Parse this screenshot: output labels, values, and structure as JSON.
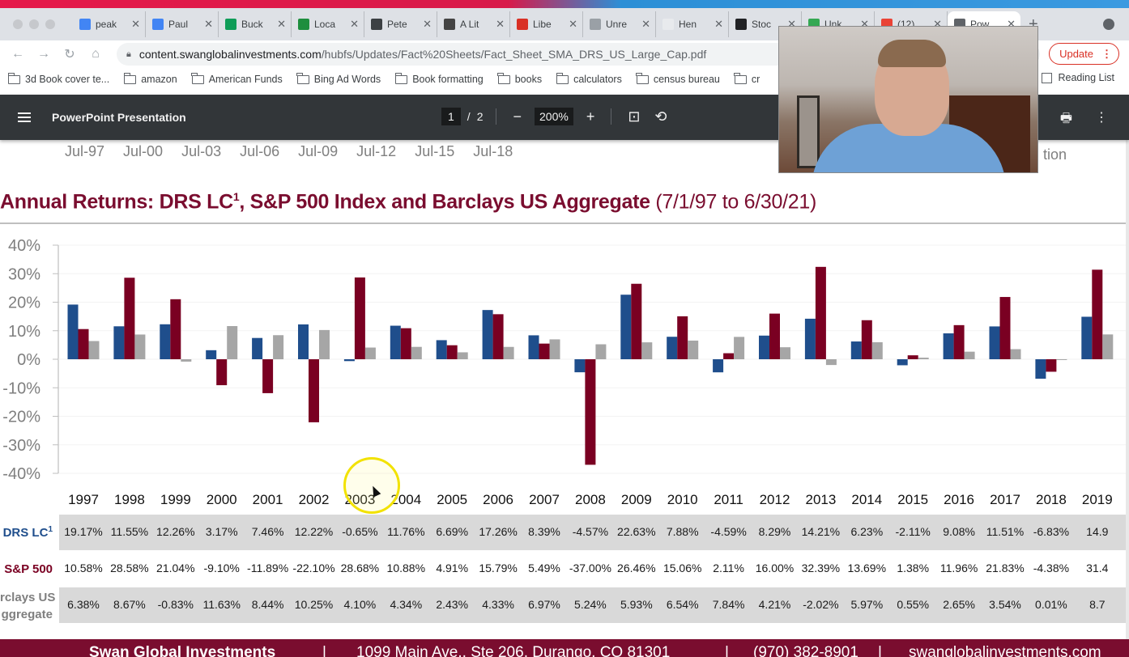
{
  "browser": {
    "tabs": [
      {
        "label": "peak",
        "icon": "google-docs-icon",
        "color": "#4285f4"
      },
      {
        "label": "Paul",
        "icon": "google-docs-icon",
        "color": "#4285f4"
      },
      {
        "label": "Buck",
        "icon": "google-sheets-icon",
        "color": "#0f9d58"
      },
      {
        "label": "Loca",
        "icon": "sheet-app-icon",
        "color": "#1e8e3e"
      },
      {
        "label": "Pete",
        "icon": "globe-icon",
        "color": "#3c4043"
      },
      {
        "label": "A Lit",
        "icon": "cube-icon",
        "color": "#444"
      },
      {
        "label": "Libe",
        "icon": "lc-icon",
        "color": "#d93025"
      },
      {
        "label": "Unre",
        "icon": "page-icon",
        "color": "#9aa0a6"
      },
      {
        "label": "Hen",
        "icon": "blank-icon",
        "color": "#e8eaed"
      },
      {
        "label": "Stoc",
        "icon": "pr-icon",
        "color": "#202124"
      },
      {
        "label": "Unk",
        "icon": "leaf-icon",
        "color": "#34a853"
      },
      {
        "label": "(12)",
        "icon": "red-dot-icon",
        "color": "#ea4335"
      },
      {
        "label": "Pow",
        "icon": "dollar-icon",
        "color": "#5f6368",
        "active": true
      }
    ],
    "new_tab": "+",
    "url_host": "content.swanglobalinvestments.com",
    "url_path": "/hubfs/Updates/Fact%20Sheets/Fact_Sheet_SMA_DRS_US_Large_Cap.pdf",
    "update_label": "Update",
    "bookmarks": [
      "3d Book cover te...",
      "amazon",
      "American Funds",
      "Bing Ad Words",
      "Book formatting",
      "books",
      "calculators",
      "census bureau",
      "cr"
    ],
    "reading_list": "Reading List"
  },
  "pdf_viewer": {
    "title": "PowerPoint Presentation",
    "page_current": "1",
    "page_total": "2",
    "page_sep": "/",
    "zoom": "200%",
    "zoom_out": "−",
    "zoom_in": "+"
  },
  "page": {
    "prev_axis_labels": [
      "Jul-97",
      "Jul-00",
      "Jul-03",
      "Jul-06",
      "Jul-09",
      "Jul-12",
      "Jul-15",
      "Jul-18"
    ],
    "prev_tail_text": "tion",
    "title_main": "Annual Returns: DRS LC",
    "title_sup": "1",
    "title_rest": ", S&P 500 Index and Barclays US Aggregate",
    "title_range": "(7/1/97 to 6/30/21)",
    "footer": {
      "company": "Swan Global Investments",
      "address": "1099 Main Ave., Ste 206, Durango, CO 81301",
      "phone": "(970) 382-8901",
      "web": "swanglobalinvestments.com",
      "sep": "|"
    }
  },
  "chart_data": {
    "type": "bar",
    "title": "Annual Returns: DRS LC1, S&P 500 Index and Barclays US Aggregate (7/1/97 to 6/30/21)",
    "xlabel": "",
    "ylabel": "",
    "ylim": [
      -40,
      40
    ],
    "yticks": [
      "40%",
      "30%",
      "20%",
      "10%",
      "0%",
      "-10%",
      "-20%",
      "-30%",
      "-40%"
    ],
    "ytick_values": [
      40,
      30,
      20,
      10,
      0,
      -10,
      -20,
      -30,
      -40
    ],
    "grid": true,
    "categories": [
      "1997",
      "1998",
      "1999",
      "2000",
      "2001",
      "2002",
      "2003",
      "2004",
      "2005",
      "2006",
      "2007",
      "2008",
      "2009",
      "2010",
      "2011",
      "2012",
      "2013",
      "2014",
      "2015",
      "2016",
      "2017",
      "2018",
      "2019"
    ],
    "series": [
      {
        "name": "DRS LC",
        "label_sup": "1",
        "color": "#1f4e8c",
        "values": [
          19.17,
          11.55,
          12.26,
          3.17,
          7.46,
          12.22,
          -0.65,
          11.76,
          6.69,
          17.26,
          8.39,
          -4.57,
          22.63,
          7.88,
          -4.59,
          8.29,
          14.21,
          6.23,
          -2.11,
          9.08,
          11.51,
          -6.83,
          14.9
        ],
        "labels": [
          "19.17%",
          "11.55%",
          "12.26%",
          "3.17%",
          "7.46%",
          "12.22%",
          "-0.65%",
          "11.76%",
          "6.69%",
          "17.26%",
          "8.39%",
          "-4.57%",
          "22.63%",
          "7.88%",
          "-4.59%",
          "8.29%",
          "14.21%",
          "6.23%",
          "-2.11%",
          "9.08%",
          "11.51%",
          "-6.83%",
          "14.9"
        ]
      },
      {
        "name": "S&P 500",
        "label_sup": "",
        "color": "#7a0022",
        "values": [
          10.58,
          28.58,
          21.04,
          -9.1,
          -11.89,
          -22.1,
          28.68,
          10.88,
          4.91,
          15.79,
          5.49,
          -37.0,
          26.46,
          15.06,
          2.11,
          16.0,
          32.39,
          13.69,
          1.38,
          11.96,
          21.83,
          -4.38,
          31.4
        ],
        "labels": [
          "10.58%",
          "28.58%",
          "21.04%",
          "-9.10%",
          "-11.89%",
          "-22.10%",
          "28.68%",
          "10.88%",
          "4.91%",
          "15.79%",
          "5.49%",
          "-37.00%",
          "26.46%",
          "15.06%",
          "2.11%",
          "16.00%",
          "32.39%",
          "13.69%",
          "1.38%",
          "11.96%",
          "21.83%",
          "-4.38%",
          "31.4"
        ]
      },
      {
        "name": "Barclays US Aggregate",
        "label_line1": "rclays US",
        "label_line2": "ggregate",
        "label_sup": "",
        "color": "#a6a6a6",
        "values": [
          6.38,
          8.67,
          -0.83,
          11.63,
          8.44,
          10.25,
          4.1,
          4.34,
          2.43,
          4.33,
          6.97,
          5.24,
          5.93,
          6.54,
          7.84,
          4.21,
          -2.02,
          5.97,
          0.55,
          2.65,
          3.54,
          0.01,
          8.7
        ],
        "labels": [
          "6.38%",
          "8.67%",
          "-0.83%",
          "11.63%",
          "8.44%",
          "10.25%",
          "4.10%",
          "4.34%",
          "2.43%",
          "4.33%",
          "6.97%",
          "5.24%",
          "5.93%",
          "6.54%",
          "7.84%",
          "4.21%",
          "-2.02%",
          "5.97%",
          "0.55%",
          "2.65%",
          "3.54%",
          "0.01%",
          "8.7"
        ]
      }
    ],
    "legend": "table-below"
  }
}
